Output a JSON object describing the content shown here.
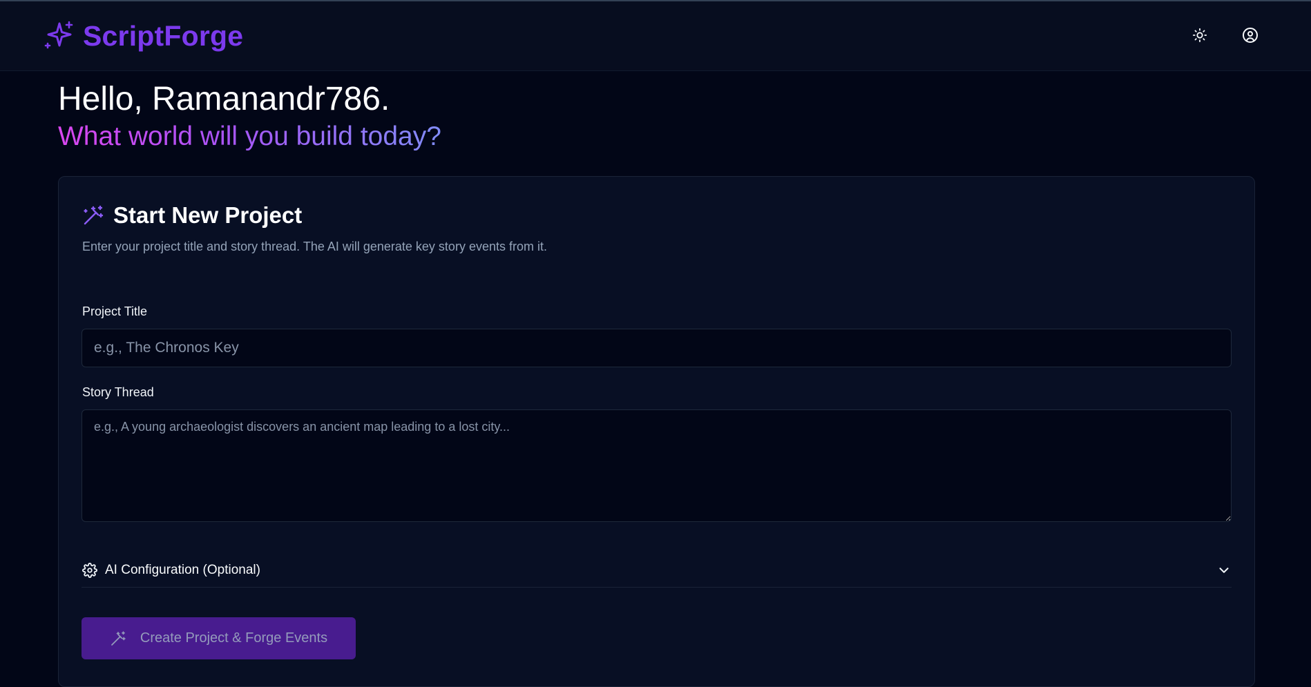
{
  "app": {
    "name": "ScriptForge",
    "logo_icon": "sparkles-icon",
    "accent_color": "#7c3aed"
  },
  "header": {
    "theme_toggle_icon": "sun-icon",
    "profile_icon": "user-circle-icon"
  },
  "greeting": {
    "hello": "Hello, Ramanandr786.",
    "prompt": "What world will you build today?"
  },
  "new_project": {
    "icon": "magic-wand-icon",
    "title": "Start New Project",
    "description": "Enter your project title and story thread. The AI will generate key story events from it.",
    "project_title_label": "Project Title",
    "project_title_placeholder": "e.g., The Chronos Key",
    "project_title_value": "",
    "story_thread_label": "Story Thread",
    "story_thread_placeholder": "e.g., A young archaeologist discovers an ancient map leading to a lost city...",
    "story_thread_value": "",
    "ai_config_label": "AI Configuration (Optional)",
    "ai_config_icon": "gear-icon",
    "ai_config_chevron": "chevron-down-icon",
    "create_button_label": "Create Project & Forge Events",
    "create_button_icon": "magic-wand-icon"
  }
}
